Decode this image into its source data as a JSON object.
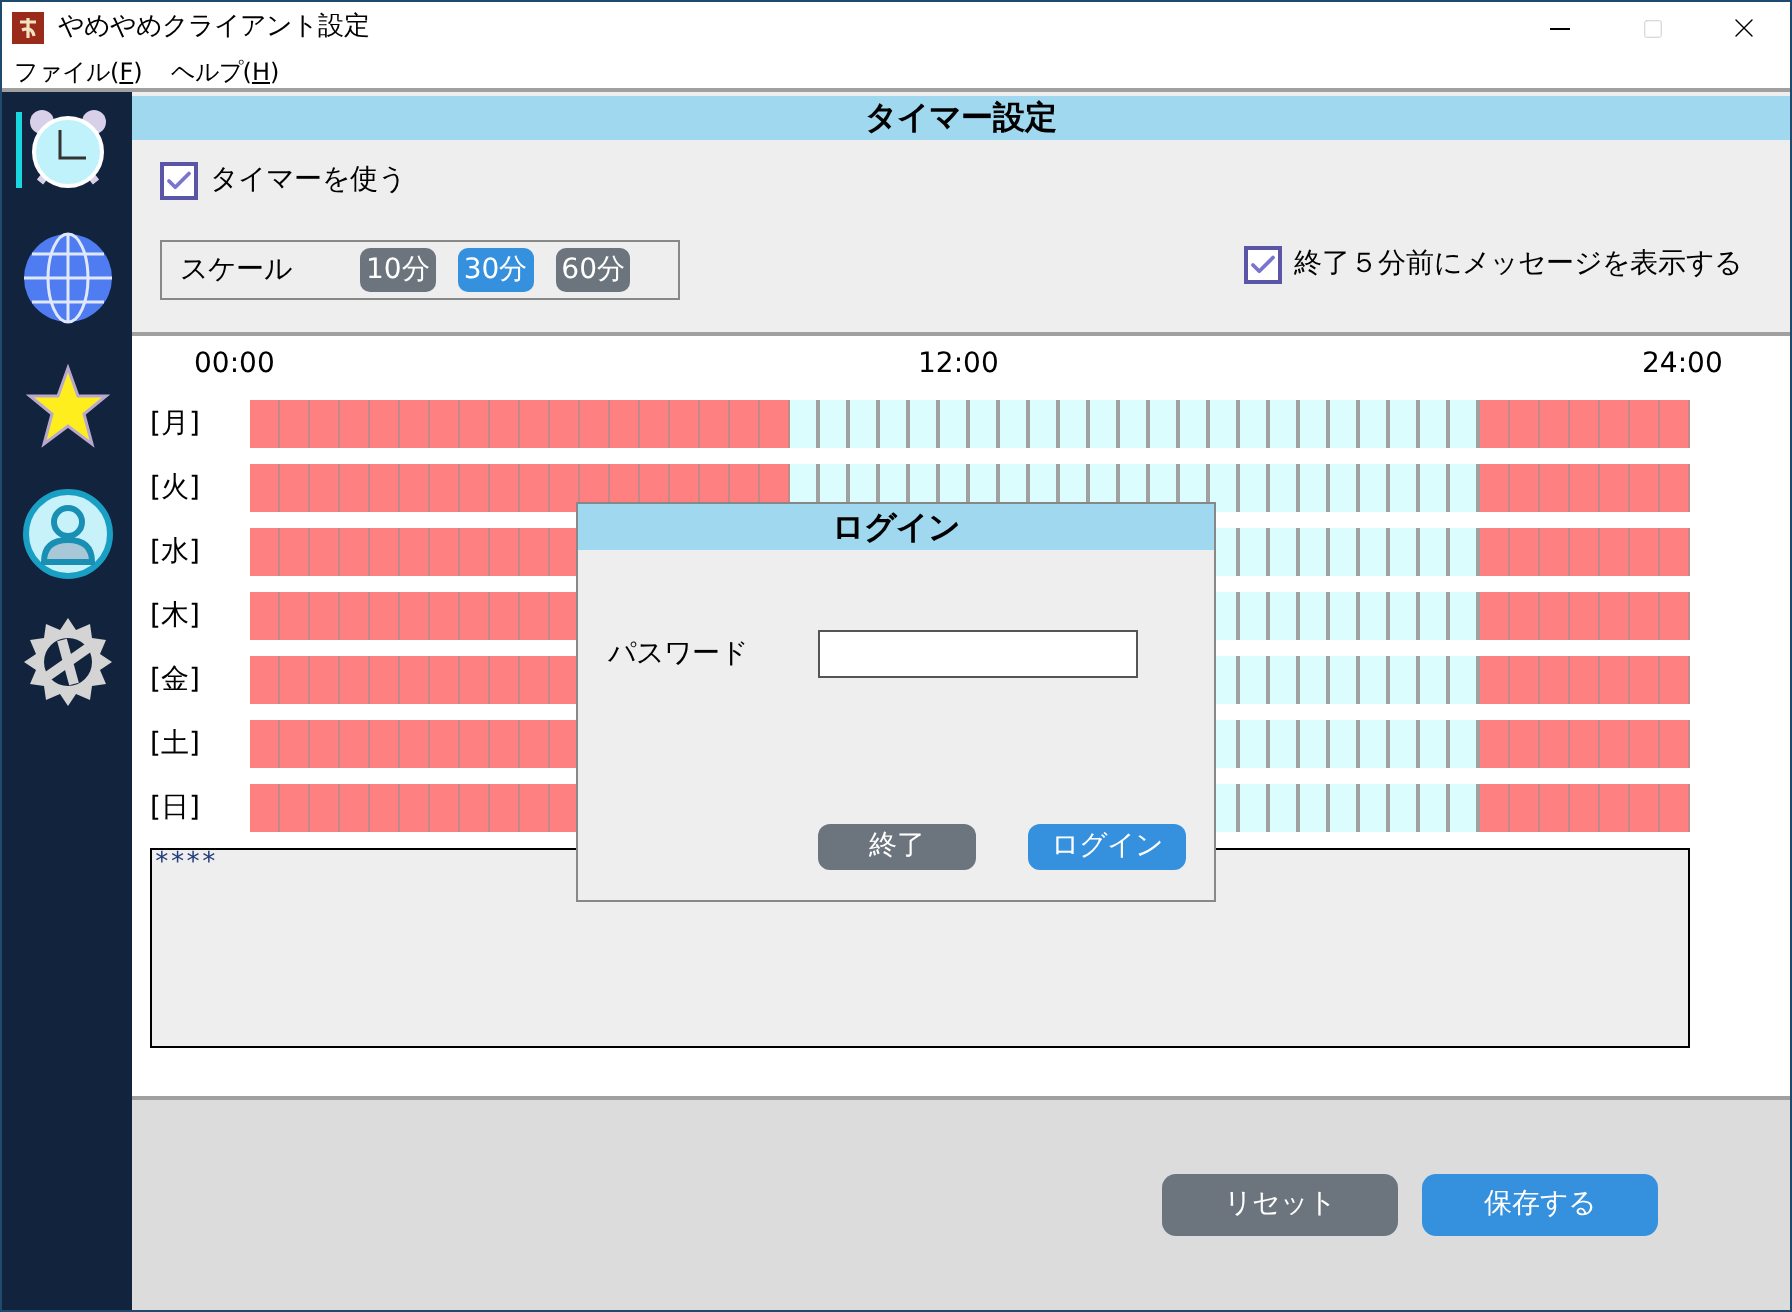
{
  "window": {
    "title": "やめやめクライアント設定"
  },
  "menu": [
    {
      "label": "ファイル(",
      "key": "F",
      "end": ")"
    },
    {
      "label": "ヘルプ(",
      "key": "H",
      "end": ")"
    }
  ],
  "sidebar": {
    "items": [
      {
        "kind": "clock",
        "selected": true
      },
      {
        "kind": "globe",
        "selected": false
      },
      {
        "kind": "star",
        "selected": false
      },
      {
        "kind": "user",
        "selected": false
      },
      {
        "kind": "gear",
        "selected": false
      }
    ]
  },
  "panel": {
    "title": "タイマー設定"
  },
  "use_timer": {
    "label": "タイマーを使う",
    "checked": true
  },
  "scale": {
    "label": "スケール",
    "options": [
      {
        "label": "10分",
        "selected": false
      },
      {
        "label": "30分",
        "selected": true
      },
      {
        "label": "60分",
        "selected": false
      }
    ]
  },
  "warn": {
    "label": "終了５分前にメッセージを表示する",
    "checked": true
  },
  "time_labels": [
    "00:00",
    "12:00",
    "24:00"
  ],
  "days": [
    {
      "label": "[月]",
      "slots": [
        true,
        true,
        true,
        true,
        true,
        true,
        true,
        true,
        true,
        true,
        true,
        true,
        true,
        true,
        true,
        true,
        true,
        true,
        false,
        false,
        false,
        false,
        false,
        false,
        false,
        false,
        false,
        false,
        false,
        false,
        false,
        false,
        false,
        false,
        false,
        false,
        false,
        false,
        false,
        false,
        false,
        true,
        true,
        true,
        true,
        true,
        true,
        true
      ]
    },
    {
      "label": "[火]",
      "slots": [
        true,
        true,
        true,
        true,
        true,
        true,
        true,
        true,
        true,
        true,
        true,
        true,
        true,
        true,
        true,
        true,
        true,
        true,
        false,
        false,
        false,
        false,
        false,
        false,
        false,
        false,
        false,
        false,
        false,
        false,
        false,
        false,
        false,
        false,
        false,
        false,
        false,
        false,
        false,
        false,
        false,
        true,
        true,
        true,
        true,
        true,
        true,
        true
      ]
    },
    {
      "label": "[水]",
      "slots": [
        true,
        true,
        true,
        true,
        true,
        true,
        true,
        true,
        true,
        true,
        true
      ],
      "slots_right": [
        false,
        false,
        false,
        false,
        false,
        false,
        false,
        false,
        false,
        true,
        true,
        true,
        true,
        true,
        true,
        true
      ]
    },
    {
      "label": "[木]",
      "slots": [
        true,
        true,
        true,
        true,
        true,
        true,
        true,
        true,
        true,
        true,
        true
      ],
      "slots_right": [
        false,
        false,
        false,
        false,
        false,
        false,
        false,
        false,
        false,
        true,
        true,
        true,
        true,
        true,
        true,
        true
      ]
    },
    {
      "label": "[金]",
      "slots": [
        true,
        true,
        true,
        true,
        true,
        true,
        true,
        true,
        true,
        true,
        true
      ],
      "slots_right": [
        false,
        false,
        false,
        false,
        false,
        false,
        false,
        false,
        false,
        true,
        true,
        true,
        true,
        true,
        true,
        true
      ]
    },
    {
      "label": "[土]",
      "slots": [
        true,
        true,
        true,
        true,
        true,
        true,
        true,
        true,
        true,
        true,
        true
      ],
      "slots_right": [
        false,
        false,
        false,
        false,
        false,
        false,
        false,
        false,
        false,
        true,
        true,
        true,
        true,
        true,
        true,
        true
      ]
    },
    {
      "label": "[日]",
      "slots": [
        true,
        true,
        true,
        true,
        true,
        true,
        true,
        true,
        true,
        true,
        true
      ],
      "slots_right": [
        false,
        false,
        false,
        false,
        false,
        false,
        false,
        false,
        false,
        true,
        true,
        true,
        true,
        true,
        true,
        true
      ]
    }
  ],
  "message_box": {
    "value": "****"
  },
  "buttons": [
    {
      "label": "リセット",
      "kind": "secondary"
    },
    {
      "label": "保存する",
      "kind": "primary"
    }
  ],
  "dialog": {
    "title": "ログイン",
    "field_label": "パスワード",
    "buttons": [
      {
        "label": "終了",
        "kind": "secondary"
      },
      {
        "label": "ログイン",
        "kind": "primary"
      }
    ]
  }
}
